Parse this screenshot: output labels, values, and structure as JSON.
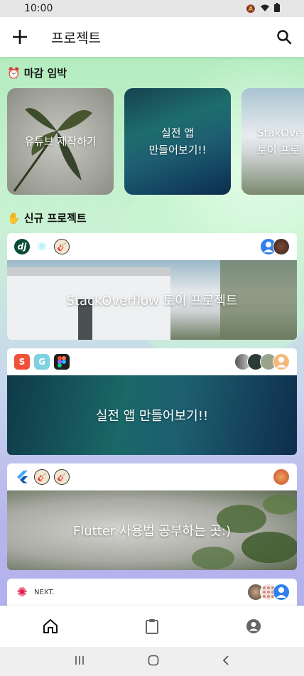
{
  "status_bar": {
    "time": "10:00"
  },
  "app_bar": {
    "title": "프로젝트"
  },
  "sections": {
    "deadline": {
      "emoji": "⏰",
      "title": "마감 임박"
    },
    "new": {
      "emoji": "✋",
      "title": "신규 프로젝트"
    }
  },
  "deadline_cards": [
    {
      "title": "유튜브 제작하기"
    },
    {
      "title": "실전 앱\n만들어보기!!"
    },
    {
      "title": "StakOve\n토이 프로"
    }
  ],
  "projects": [
    {
      "title": "StackOverflow 토이 프로젝트",
      "tags": [
        "django-icon",
        "react-icon",
        "guitar-icon"
      ]
    },
    {
      "title": "실전 앱 만들어보기!!",
      "tags": [
        "swift-icon",
        "go-icon",
        "figma-icon"
      ]
    },
    {
      "title": "Flutter 사용법 공부하는 곳:)",
      "tags": [
        "flutter-icon",
        "guitar-icon",
        "guitar-icon"
      ]
    },
    {
      "title": "",
      "tags": [
        "nestjs-icon",
        "nextjs-icon"
      ],
      "next_label": "NEXT."
    }
  ],
  "colors": {
    "accent_blue": "#2f80ed",
    "django": "#0c4b33",
    "react": "#61dafb",
    "swift": "#f05138",
    "figma": "#1e1e1e",
    "flutter": "#42a5f5",
    "nest": "#e0234e"
  }
}
